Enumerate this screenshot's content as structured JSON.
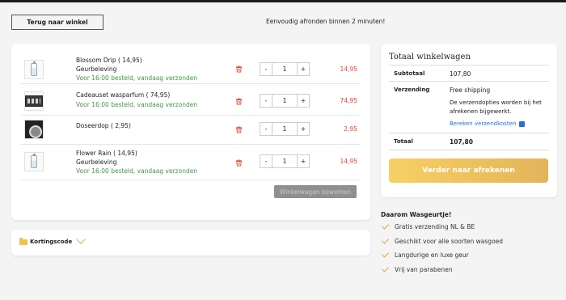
{
  "header": {
    "back_label": "Terug naar winkel",
    "tagline": "Eenvoudig afronden binnen 2 minuten!"
  },
  "cart": {
    "items": [
      {
        "name": "Blossom Drip ( 14,95)",
        "variant": "Geurbeleving",
        "shipping": "Voor 16:00 besteld, vandaag verzonden",
        "qty": "1",
        "price": "14,95",
        "image": "perfume-bottle"
      },
      {
        "name": "Cadeauset wasparfum ( 74,95)",
        "variant": "",
        "shipping": "Voor 16:00 besteld, vandaag verzonden",
        "qty": "1",
        "price": "74,95",
        "image": "gift-set"
      },
      {
        "name": "Doseerdop ( 2,95)",
        "variant": "",
        "shipping": "",
        "qty": "1",
        "price": "2,95",
        "image": "dosing-cap"
      },
      {
        "name": "Flower Rain ( 14,95)",
        "variant": "Geurbeleving",
        "shipping": "Voor 16:00 besteld, vandaag verzonden",
        "qty": "1",
        "price": "14,95",
        "image": "perfume-bottle"
      }
    ],
    "qty_minus": "-",
    "qty_plus": "+",
    "update_label": "Winkelwagen bijwerken"
  },
  "coupon": {
    "label": "Kortingscode"
  },
  "totals": {
    "title": "Totaal winkelwagen",
    "subtotal_label": "Subtotaal",
    "subtotal_value": "107,80",
    "shipping_label": "Verzending",
    "shipping_value": "Free shipping",
    "shipping_note": "De verzendopties worden bij het afrekenen bijgewerkt.",
    "calc_link": "Bereken verzendkosten",
    "total_label": "Totaal",
    "total_value": "107,80",
    "checkout_label": "Verder naar afrekenen"
  },
  "why": {
    "title": "Daarom Wasgeurtje!",
    "items": [
      "Gratis verzending NL & BE",
      "Geschikt voor alle soorten wasgoed",
      "Langdurige en luxe geur",
      "Vrij van parabenen"
    ]
  },
  "colors": {
    "price_red": "#e0463a",
    "ship_green": "#3f9a3f",
    "accent_gold": "#e3b45a",
    "link_blue": "#2a6cd8"
  }
}
